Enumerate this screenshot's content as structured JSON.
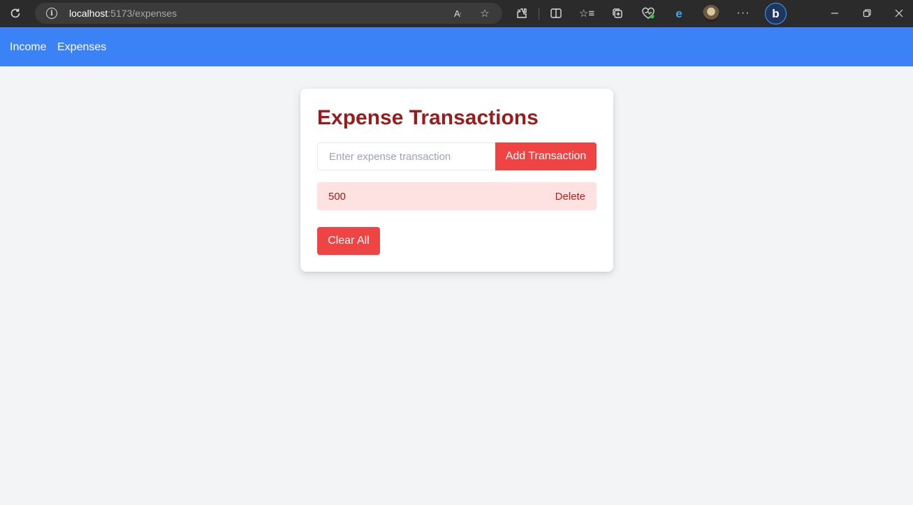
{
  "browser": {
    "url_host": "localhost",
    "url_path": ":5173/expenses",
    "icons": {
      "reload": "reload-icon",
      "info": "site-info-icon",
      "read_aloud": "read-aloud-icon",
      "favorite": "add-favorite-icon",
      "extensions": "extensions-icon",
      "split_screen": "split-screen-icon",
      "favorites": "favorites-icon",
      "collections": "collections-icon",
      "health": "browser-essentials-icon",
      "edge": "edge-icon",
      "profile": "profile-avatar",
      "more": "more-icon",
      "copilot": "bing-copilot-icon",
      "minimize": "minimize-icon",
      "restore": "restore-icon",
      "close": "close-icon"
    }
  },
  "nav": {
    "links": [
      "Income",
      "Expenses"
    ]
  },
  "card": {
    "title": "Expense Transactions",
    "input_placeholder": "Enter expense transaction",
    "input_value": "",
    "add_label": "Add Transaction",
    "transactions": [
      {
        "amount": "500",
        "delete_label": "Delete"
      }
    ],
    "clear_label": "Clear All"
  },
  "colors": {
    "nav_bg": "#3b82f6",
    "accent_red": "#ef4444",
    "title_red": "#991b1b",
    "row_bg": "#fee2e2",
    "page_bg": "#f3f4f6"
  }
}
